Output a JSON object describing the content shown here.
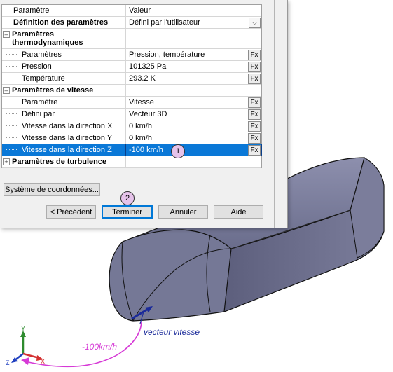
{
  "grid": {
    "header": {
      "name": "Paramètre",
      "value": "Valeur"
    },
    "rows": [
      {
        "name": "Définition des paramètres",
        "value": "Défini par l'utilisateur"
      },
      {
        "name": "Paramètres thermodynamiques"
      },
      {
        "name": "Paramètres",
        "value": "Pression, température",
        "fx": "Fx"
      },
      {
        "name": "Pression",
        "value": "101325 Pa",
        "fx": "Fx"
      },
      {
        "name": "Température",
        "value": "293.2 K",
        "fx": "Fx"
      },
      {
        "name": "Paramètres de vitesse"
      },
      {
        "name": "Paramètre",
        "value": "Vitesse",
        "fx": "Fx"
      },
      {
        "name": "Défini par",
        "value": "Vecteur 3D",
        "fx": "Fx"
      },
      {
        "name": "Vitesse dans la direction X",
        "value": "0 km/h",
        "fx": "Fx"
      },
      {
        "name": "Vitesse dans la direction Y",
        "value": "0 km/h",
        "fx": "Fx"
      },
      {
        "name": "Vitesse dans la direction Z",
        "value": "-100 km/h",
        "fx": "Fx"
      },
      {
        "name": "Paramètres de turbulence"
      }
    ]
  },
  "buttons": {
    "coord": "Système de coordonnées...",
    "prev": "< Précédent",
    "finish": "Terminer",
    "cancel": "Annuler",
    "help": "Aide"
  },
  "badges": {
    "b1": "1",
    "b2": "2"
  },
  "annotations": {
    "vector_label": "vecteur vitesse",
    "speed_label": "-100km/h"
  },
  "triad": {
    "y": "Y",
    "x": "X",
    "z": "Z"
  },
  "colors": {
    "selection": "#0a78d7",
    "annotation_magenta": "#d63ad6",
    "vector_blue": "#1a2a9a",
    "model_fill": "#6b6e8c"
  }
}
